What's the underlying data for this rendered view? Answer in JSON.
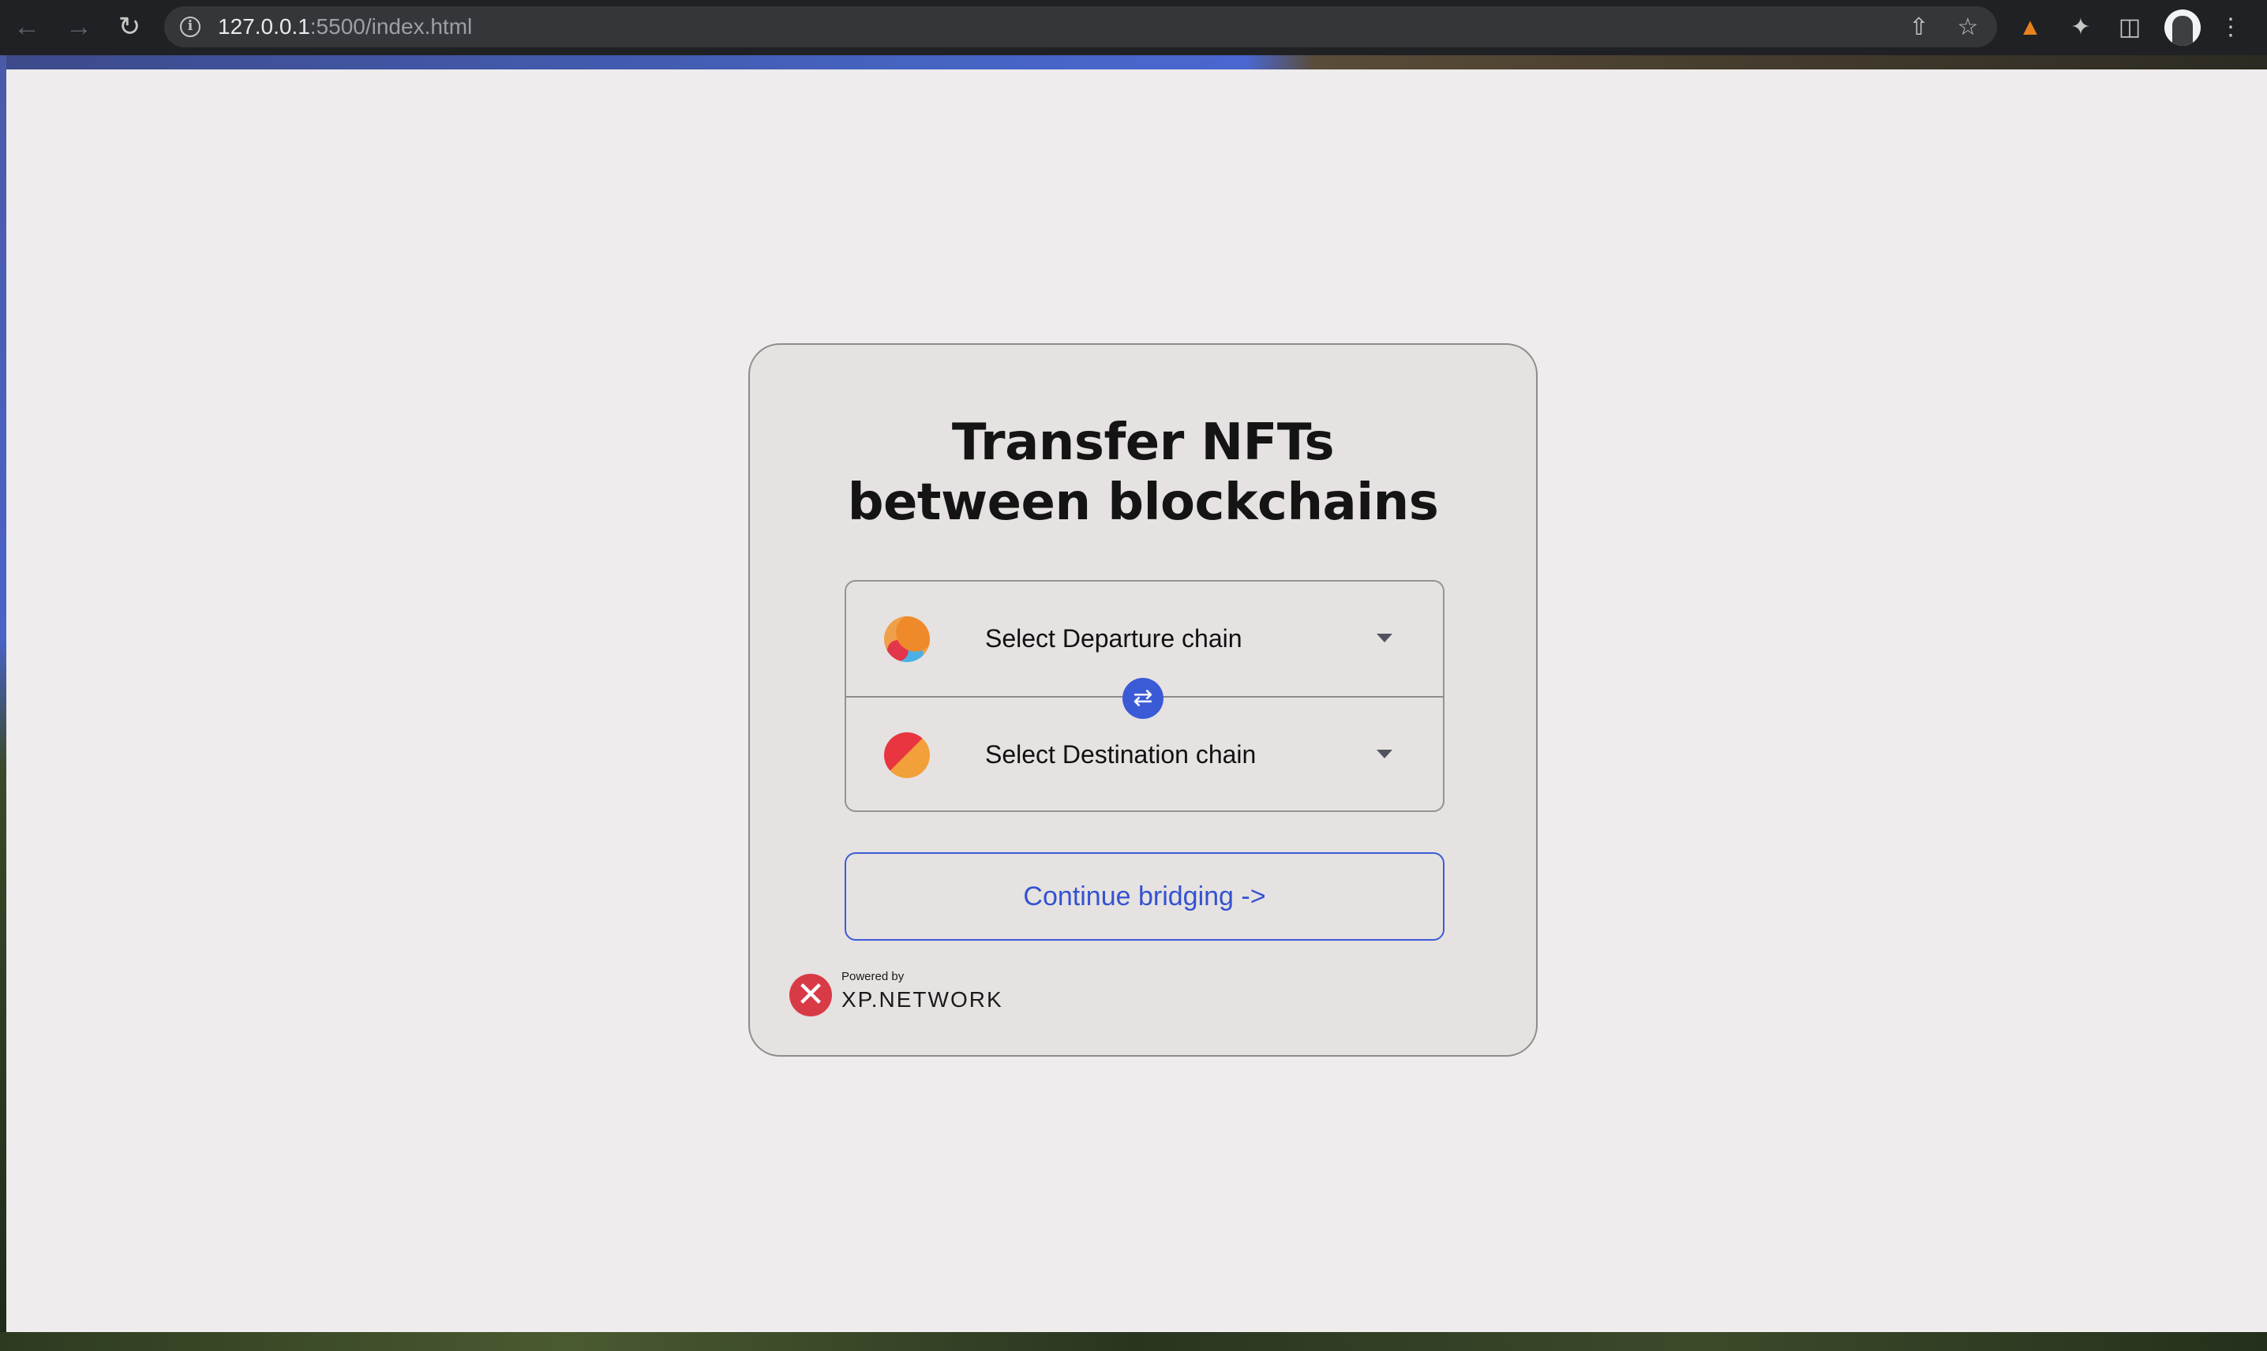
{
  "browser": {
    "url_host": "127.0.0.1",
    "url_path": ":5500/index.html",
    "icons": {
      "back": "arrow-left-icon",
      "forward": "arrow-right-icon",
      "reload": "reload-icon",
      "info": "info-icon",
      "share": "share-icon",
      "bookmark": "star-icon",
      "metamask": "fox-icon",
      "extensions": "puzzle-icon",
      "side_panel": "side-panel-icon",
      "profile": "avatar",
      "menu": "kebab-menu-icon"
    }
  },
  "card": {
    "title_line1": "Transfer NFTs",
    "title_line2": "between blockchains",
    "departure_label": "Select Departure chain",
    "destination_label": "Select Destination chain",
    "continue_label": "Continue bridging ->",
    "powered_by": "Powered by",
    "brand": "XP.NETWORK"
  },
  "colors": {
    "accent": "#3b5ad6",
    "page_bg": "#eeecec",
    "card_bg": "#e5e2e1",
    "brand_red": "#d83a46"
  }
}
